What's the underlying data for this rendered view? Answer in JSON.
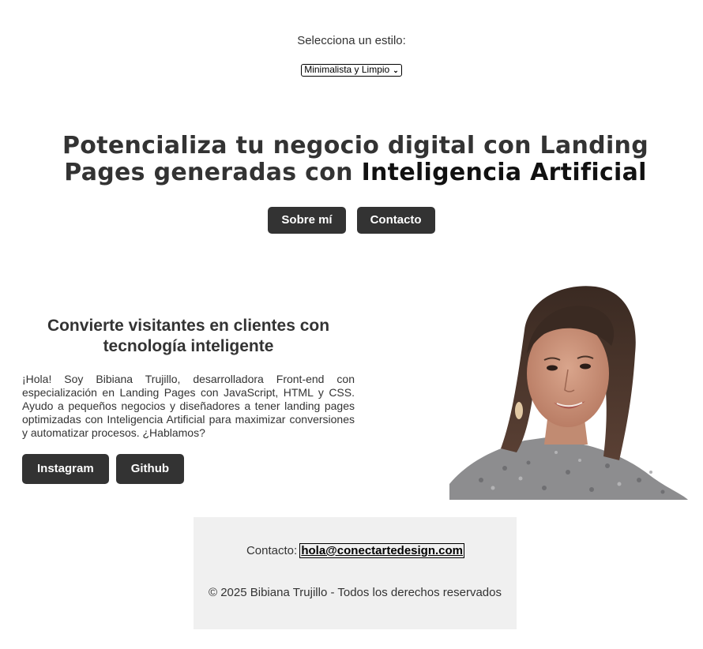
{
  "style_selector": {
    "label": "Selecciona un estilo:",
    "selected": "Minimalista y Limpio"
  },
  "hero": {
    "title_part1": "Potencializa tu negocio digital con Landing Pages generadas con ",
    "title_accent": "Inteligencia Artificial",
    "buttons": {
      "about": "Sobre mí",
      "contact": "Contacto"
    }
  },
  "about": {
    "heading": "Convierte visitantes en clientes con tecnología inteligente",
    "text": "¡Hola! Soy Bibiana Trujillo, desarrolladora Front-end con especialización en Landing Pages con JavaScript, HTML y CSS. Ayudo a pequeños negocios y diseñadores a tener landing pages optimizadas con Inteligencia Artificial para maximizar conversiones y automatizar procesos. ¿Hablamos?",
    "buttons": {
      "instagram": "Instagram",
      "github": "Github"
    }
  },
  "footer": {
    "contact_label": "Contacto: ",
    "email": "hola@conectartedesign.com",
    "copyright": "© 2025 Bibiana Trujillo - Todos los derechos reservados"
  },
  "colors": {
    "button_bg": "#333333",
    "button_text": "#ffffff",
    "footer_bg": "#f0f0f0",
    "text": "#333333"
  }
}
